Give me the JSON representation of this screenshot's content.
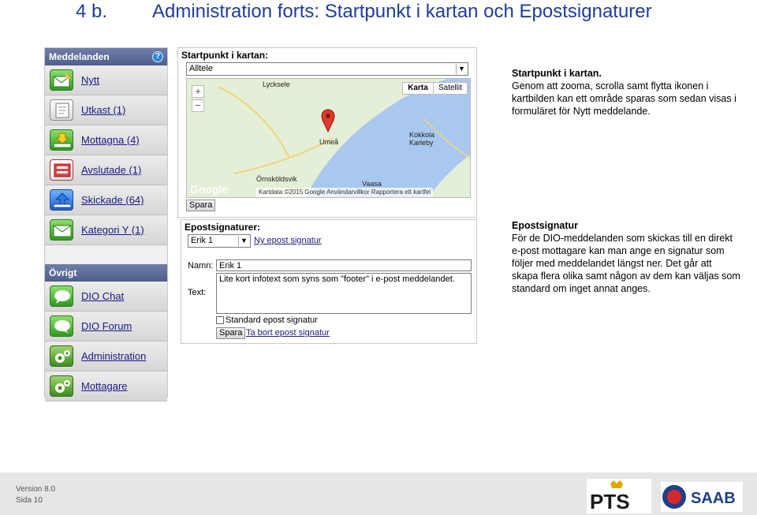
{
  "slide": {
    "number": "4 b.",
    "title": "Administration forts: Startpunkt i kartan och Epostsignaturer"
  },
  "sidebar": {
    "section1": "Meddelanden",
    "help_icon": "?",
    "items": [
      {
        "label": "Nytt",
        "icon": "new-message-icon"
      },
      {
        "label": "Utkast (1)",
        "icon": "draft-icon"
      },
      {
        "label": "Mottagna (4)",
        "icon": "inbox-icon"
      },
      {
        "label": "Avslutade (1)",
        "icon": "closed-icon"
      },
      {
        "label": "Skickade (64)",
        "icon": "sent-icon"
      },
      {
        "label": "Kategori Y (1)",
        "icon": "category-icon"
      }
    ],
    "section2": "Övrigt",
    "items2": [
      {
        "label": "DIO Chat",
        "icon": "chat-icon"
      },
      {
        "label": "DIO Forum",
        "icon": "forum-icon"
      },
      {
        "label": "Administration",
        "icon": "gear-icon"
      },
      {
        "label": "Mottagare",
        "icon": "gear-icon"
      }
    ]
  },
  "map_panel": {
    "heading": "Startpunkt i kartan:",
    "select_value": "Alltele",
    "zoom_in": "+",
    "zoom_out": "−",
    "map_types": [
      "Karta",
      "Satellit"
    ],
    "labels": [
      "Lycksele",
      "Umeå",
      "Kokkola",
      "Karleby",
      "Örnsköldsvik",
      "Vaasa"
    ],
    "google": "Google",
    "attribution": "Kartdata ©2015 Google   Användarvillkor   Rapportera ett kartfel",
    "save": "Spara"
  },
  "sig_panel": {
    "heading": "Epostsignaturer:",
    "select_value": "Erik 1",
    "new_link": "Ny epost signatur",
    "name_label": "Namn:",
    "name_value": "Erik 1",
    "text_label": "Text:",
    "text_value": "Lite kort infotext som syns som \"footer\" i e-post meddelandet.",
    "checkbox_label": "Standard epost signatur",
    "save": "Spara",
    "delete_link": "Ta bort epost signatur"
  },
  "description": {
    "map_title": "Startpunkt i kartan.",
    "map_text": "Genom att zooma, scrolla samt flytta ikonen i kartbilden kan ett område sparas som sedan visas i formuläret för Nytt meddelande.",
    "sig_title": "Epostsignatur",
    "sig_text": "För de DIO-meddelanden som skickas till en direkt e-post mottagare kan man ange en signatur som följer med meddelandet längst ner. Det går att skapa flera olika samt någon av dem kan väljas som standard om inget annat anges."
  },
  "footer": {
    "version": "Version  8.0",
    "page": "Sida  10",
    "logo1": "PTS",
    "logo2": "SAAB"
  },
  "colors": {
    "title": "#1f3d99",
    "sidebar_head": "#5d6c98",
    "link": "#1a1a8a",
    "water": "#a8c8f0",
    "land": "#e3efd6"
  }
}
